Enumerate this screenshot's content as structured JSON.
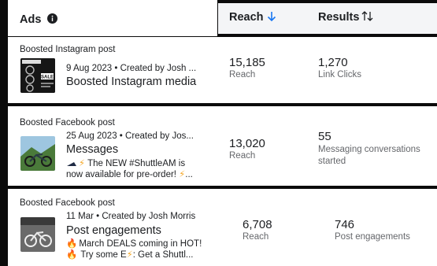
{
  "header": {
    "ads_label": "Ads",
    "reach_label": "Reach",
    "results_label": "Results"
  },
  "rows": [
    {
      "type_label": "Boosted Instagram post",
      "meta": "9 Aug 2023 • Created by Josh ...",
      "title": "Boosted Instagram media",
      "reach_value": "15,185",
      "reach_sub": "Reach",
      "results_value": "1,270",
      "results_sub": "Link Clicks"
    },
    {
      "type_label": "Boosted Facebook post",
      "meta": "25 Aug 2023 • Created by Jos...",
      "title": "Messages",
      "desc_line1": "The NEW #ShuttleAM is",
      "desc_line2": "now available for pre-order! ",
      "desc_line2_tail": "...",
      "reach_value": "13,020",
      "reach_sub": "Reach",
      "results_value": "55",
      "results_sub_line1": "Messaging conversations",
      "results_sub_line2": "started"
    },
    {
      "type_label": "Boosted Facebook post",
      "meta": "11 Mar • Created by Josh Morris",
      "title": "Post engagements",
      "desc_line1": "March DEALS coming in HOT!",
      "desc_line2": "Try some E",
      "desc_line2_tail": ": Get a Shuttl...",
      "reach_value": "6,708",
      "reach_sub": "Reach",
      "results_value": "746",
      "results_sub": "Post engagements"
    }
  ],
  "thumb1_text": "SALE",
  "colors": {
    "accent": "#1877f2",
    "text": "#1c1e21",
    "secondary": "#65676b",
    "background": "#0b0b0b"
  },
  "icons": [
    "info-icon",
    "sort-down-arrow-icon",
    "sort-updown-icon",
    "lightning-icon",
    "fire-icon",
    "bike-icon"
  ]
}
